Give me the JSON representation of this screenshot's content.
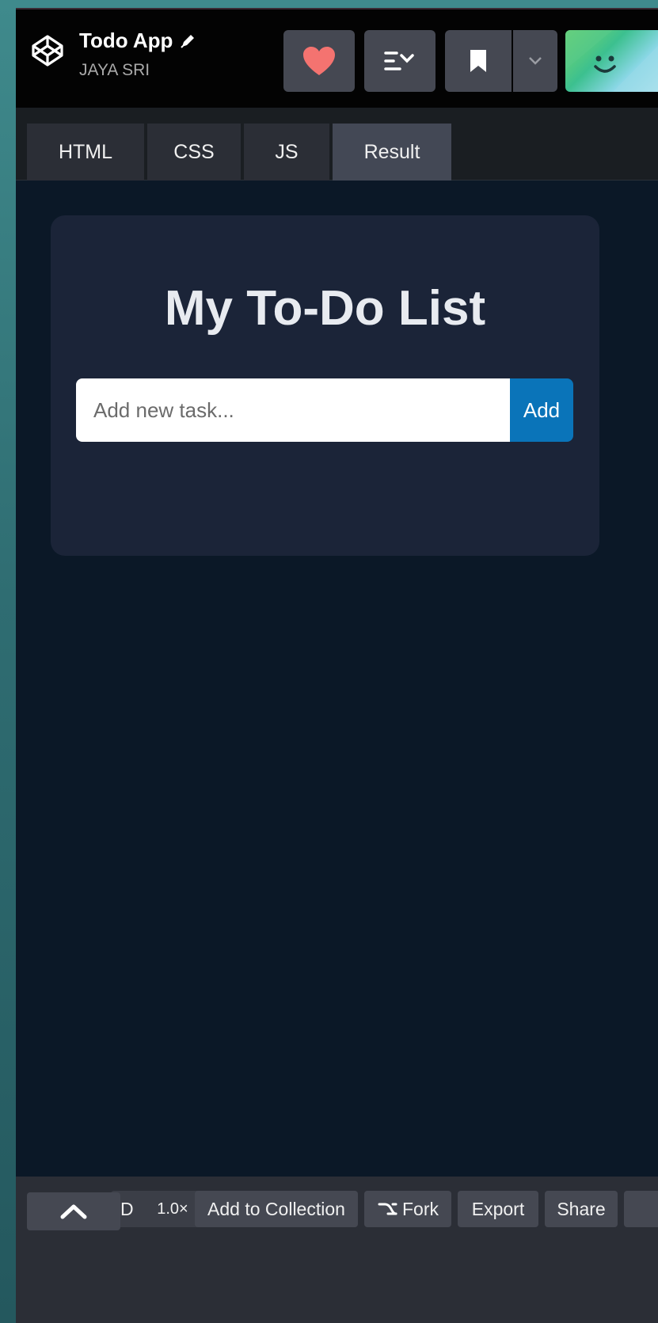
{
  "header": {
    "title": "Todo App",
    "author": "JAYA SRI"
  },
  "tabs": [
    {
      "label": "HTML"
    },
    {
      "label": "CSS"
    },
    {
      "label": "JS"
    },
    {
      "label": "Result"
    }
  ],
  "result": {
    "heading": "My To-Do List",
    "input_placeholder": "Add new task...",
    "add_label": "Add"
  },
  "footer": {
    "d_label": "D",
    "zoom": "1.0×",
    "collection_label": "Add to Collection",
    "fork_label": "Fork",
    "export_label": "Export",
    "share_label": "Share"
  },
  "colors": {
    "heart": "#f47370",
    "add_button": "#0a74b9",
    "card": "#1b2438",
    "background": "#0b1827"
  },
  "icons": [
    "codepen-logo-icon",
    "pencil-icon",
    "heart-icon",
    "layout-icon",
    "bookmark-icon",
    "chevron-down-icon",
    "smiley-avatar-icon",
    "chevron-up-icon",
    "fork-icon"
  ]
}
